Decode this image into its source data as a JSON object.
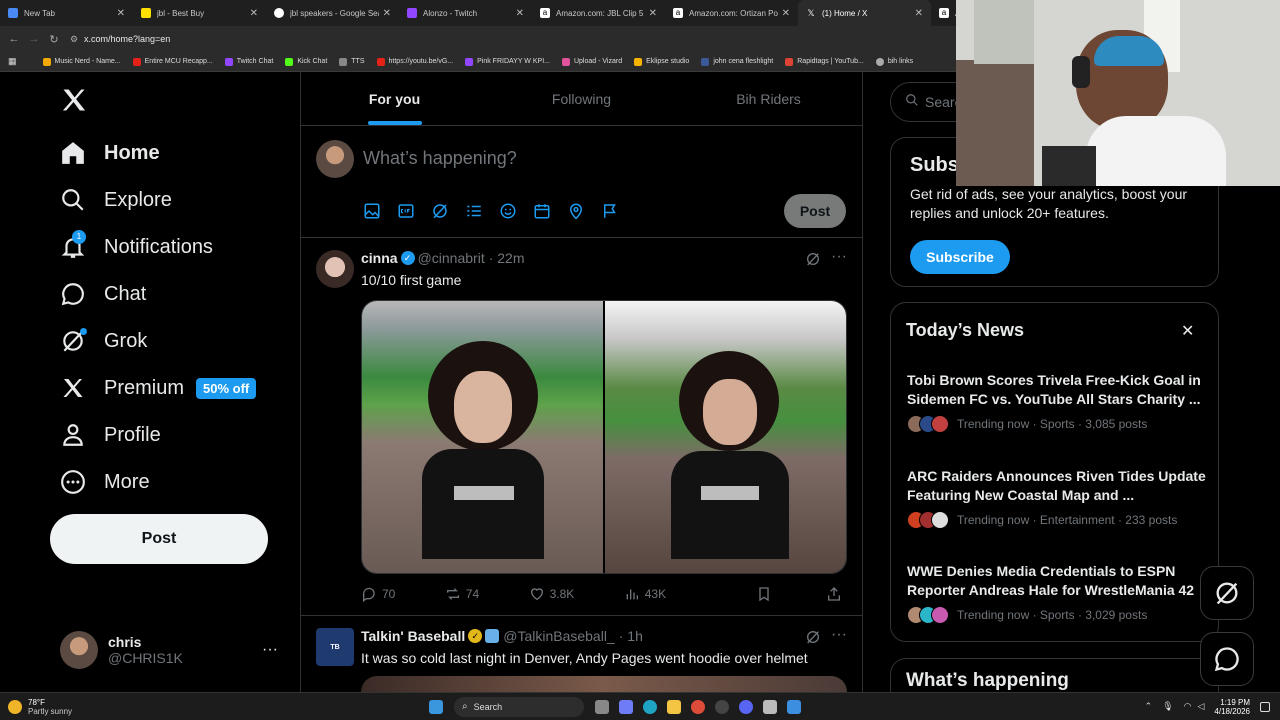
{
  "browser": {
    "tabs": [
      {
        "title": "New Tab",
        "icon": "chrome-icon"
      },
      {
        "title": "jbl - Best Buy",
        "icon": "bestbuy-icon"
      },
      {
        "title": "jbl speakers - Google Search",
        "icon": "google-icon"
      },
      {
        "title": "Alonzo - Twitch",
        "icon": "twitch-icon"
      },
      {
        "title": "Amazon.com: JBL Clip 5 -",
        "icon": "amazon-icon"
      },
      {
        "title": "Amazon.com: Ortizan Port",
        "icon": "amazon-icon"
      },
      {
        "title": "(1) Home / X",
        "icon": "x-icon"
      },
      {
        "title": "A",
        "icon": "amazon-icon"
      }
    ],
    "url": "x.com/home?lang=en",
    "bookmarks": [
      "Music Nerd - Name...",
      "Entire MCU Recapp...",
      "Twitch Chat",
      "Kick Chat",
      "TTS",
      "https://youtu.be/vG...",
      "Pink FRIDAYY W KPI...",
      "Upload - Vizard",
      "Eklipse studio",
      "john cena fleshlight",
      "Rapidtags | YouTub...",
      "bih links"
    ]
  },
  "nav": {
    "home": "Home",
    "explore": "Explore",
    "notifications": "Notifications",
    "notifications_badge": "1",
    "chat": "Chat",
    "grok": "Grok",
    "premium": "Premium",
    "premium_badge": "50% off",
    "profile": "Profile",
    "more": "More",
    "post": "Post"
  },
  "account": {
    "name": "chris",
    "handle": "@CHRIS1K",
    "more": "···"
  },
  "feed": {
    "tabs": [
      "For you",
      "Following",
      "Bih Riders"
    ],
    "compose_placeholder": "What’s happening?",
    "post_button": "Post",
    "tweets": [
      {
        "name": "cinna",
        "handle": "@cinnabrit",
        "time": "· 22m",
        "text": "10/10 first game",
        "replies": "70",
        "retweets": "74",
        "likes": "3.8K",
        "views": "43K"
      },
      {
        "name": "Talkin' Baseball",
        "handle": "@TalkinBaseball_",
        "time": "· 1h",
        "text": "It was so cold last night in Denver, Andy Pages went hoodie over helmet"
      }
    ]
  },
  "sidebar": {
    "search_placeholder": "Searc",
    "subscribe": {
      "title": "Subs",
      "text": "Get rid of ads, see your analytics, boost your replies and unlock 20+ features.",
      "button": "Subscribe"
    },
    "news_title": "Today’s News",
    "news": [
      {
        "title": "Tobi Brown Scores Trivela Free-Kick Goal in Sidemen FC vs. YouTube All Stars Charity ...",
        "meta": "Trending now · Sports · 3,085 posts"
      },
      {
        "title": "ARC Raiders Announces Riven Tides Update Featuring New Coastal Map and ...",
        "meta": "Trending now · Entertainment · 233 posts"
      },
      {
        "title": "WWE Denies Media Credentials to ESPN Reporter Andreas Hale for WrestleMania 42",
        "meta": "Trending now · Sports · 3,029 posts"
      }
    ],
    "whats_happening": "What’s happening"
  },
  "taskbar": {
    "weather_temp": "78°F",
    "weather_text": "Partly sunny",
    "search": "Search",
    "time": "1:19 PM",
    "date": "4/18/2026"
  },
  "colors": {
    "accent": "#1d9bf0",
    "bg": "#000000",
    "border": "#2f3336",
    "muted": "#71767b"
  }
}
